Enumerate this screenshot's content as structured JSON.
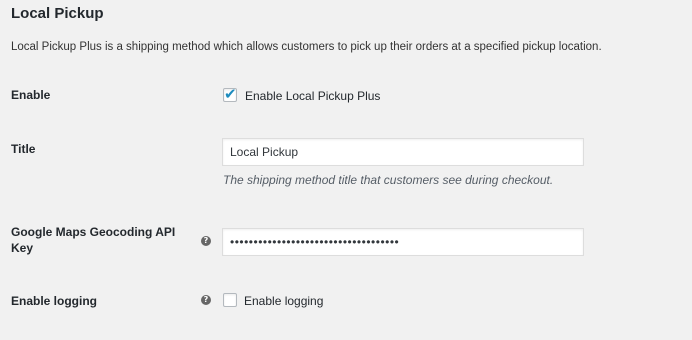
{
  "section": {
    "title": "Local Pickup",
    "description": "Local Pickup Plus is a shipping method which allows customers to pick up their orders at a specified pickup location."
  },
  "enable": {
    "label": "Enable",
    "checked": true,
    "checkbox_label": "Enable Local Pickup Plus"
  },
  "title_field": {
    "label": "Title",
    "value": "Local Pickup",
    "description": "The shipping method title that customers see during checkout."
  },
  "api_key": {
    "label_line1": "Google Maps Geocoding API",
    "label_line2": "Key",
    "help_icon": "help-tip-icon",
    "value": "••••••••••••••••••••••••••••••••••••"
  },
  "logging": {
    "label": "Enable logging",
    "help_icon": "help-tip-icon",
    "checked": false,
    "checkbox_label": "Enable logging"
  },
  "colors": {
    "background": "#f1f1f1",
    "check_accent": "#1e8cbe"
  }
}
